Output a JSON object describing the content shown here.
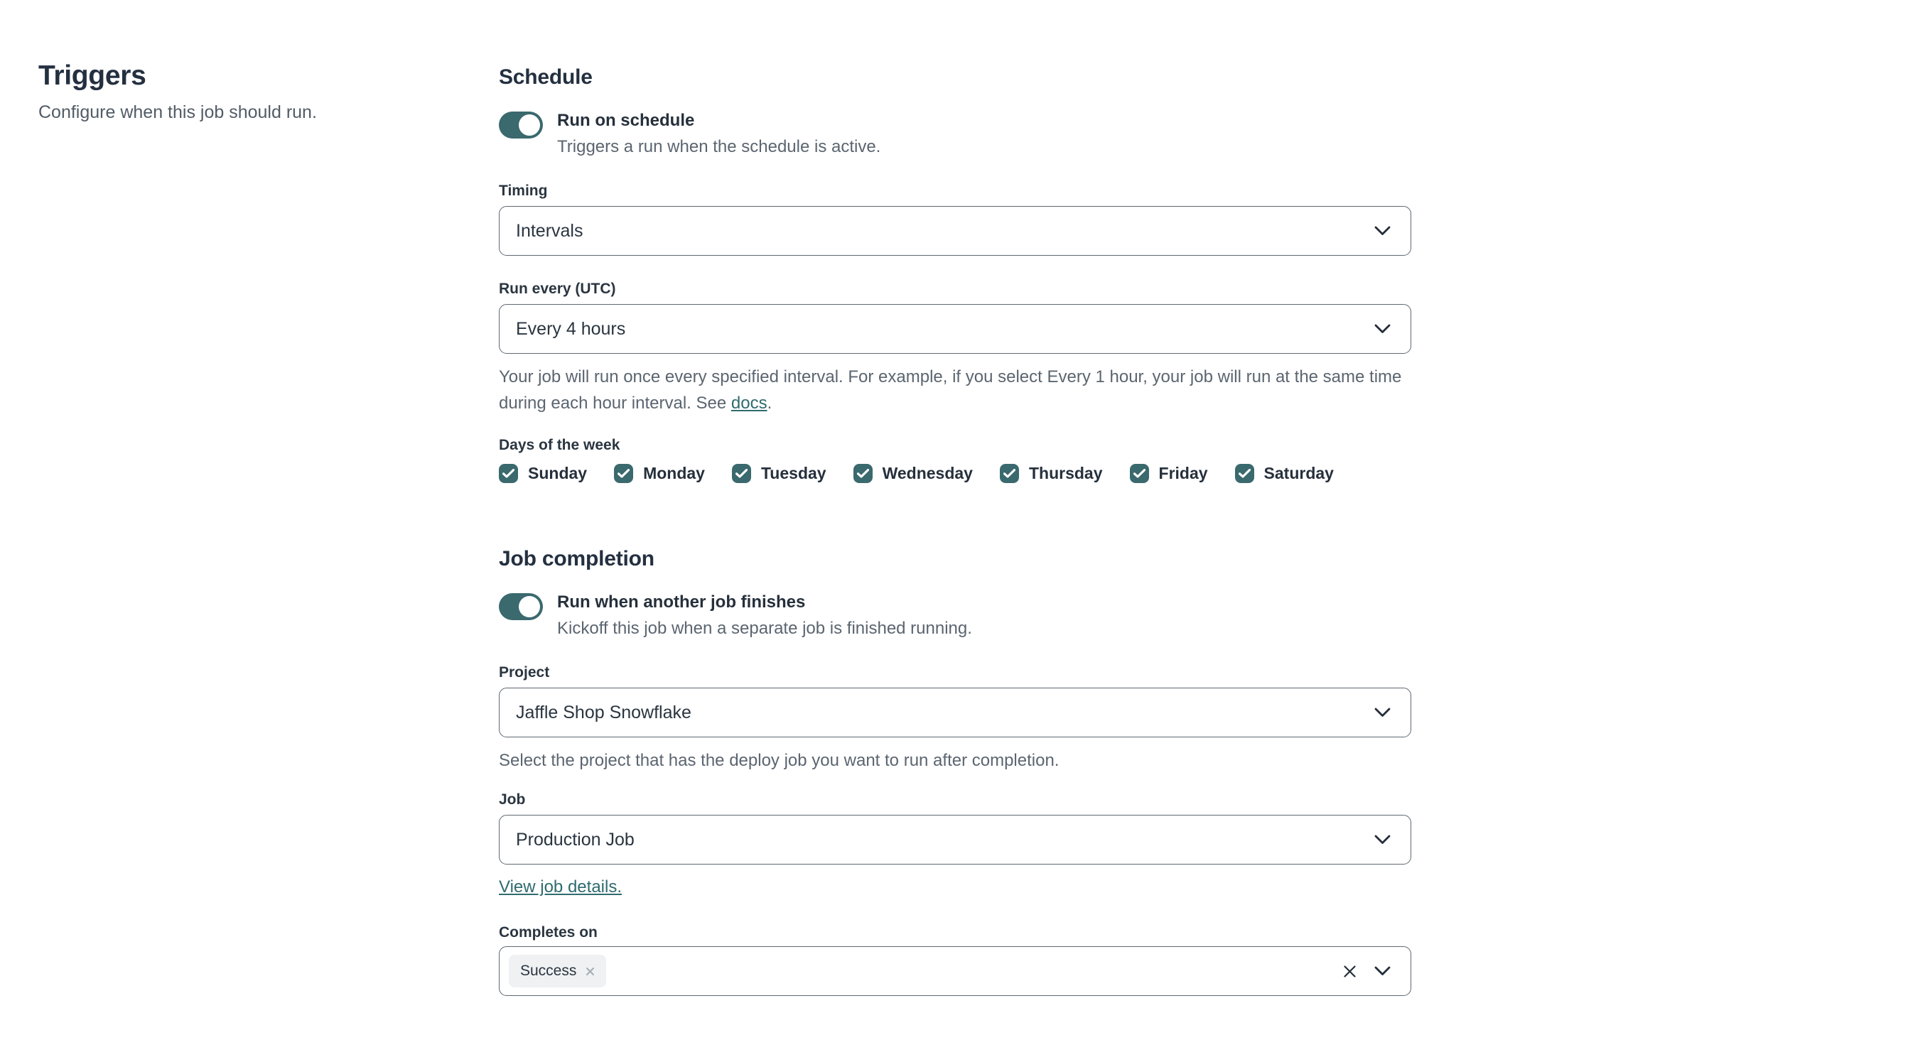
{
  "left": {
    "title": "Triggers",
    "subtitle": "Configure when this job should run."
  },
  "schedule": {
    "heading": "Schedule",
    "run_on_schedule": {
      "label": "Run on schedule",
      "description": "Triggers a run when the schedule is active.",
      "state": "on"
    },
    "timing": {
      "label": "Timing",
      "value": "Intervals"
    },
    "run_every": {
      "label": "Run every (UTC)",
      "value": "Every 4 hours",
      "help_text": "Your job will run once every specified interval. For example, if you select Every 1 hour, your job will run at the same time during each hour interval. See ",
      "help_link_label": "docs",
      "help_suffix": "."
    },
    "days": {
      "label": "Days of the week",
      "items": [
        {
          "label": "Sunday",
          "checked": true
        },
        {
          "label": "Monday",
          "checked": true
        },
        {
          "label": "Tuesday",
          "checked": true
        },
        {
          "label": "Wednesday",
          "checked": true
        },
        {
          "label": "Thursday",
          "checked": true
        },
        {
          "label": "Friday",
          "checked": true
        },
        {
          "label": "Saturday",
          "checked": true
        }
      ]
    }
  },
  "job_completion": {
    "heading": "Job completion",
    "run_when_finishes": {
      "label": "Run when another job finishes",
      "description": "Kickoff this job when a separate job is finished running.",
      "state": "on"
    },
    "project": {
      "label": "Project",
      "value": "Jaffle Shop Snowflake",
      "help_text": "Select the project that has the deploy job you want to run after completion."
    },
    "job": {
      "label": "Job",
      "value": "Production Job",
      "details_link_label": "View job details."
    },
    "completes_on": {
      "label": "Completes on",
      "chips": [
        {
          "label": "Success"
        }
      ]
    }
  },
  "colors": {
    "accent_teal": "#3a696e",
    "link_teal": "#2f6b6e",
    "heading_navy": "#243040",
    "secondary_gray": "#5b6570",
    "border_gray": "#5f6871",
    "chip_background": "#eff1f3"
  },
  "icons": {
    "chevron_down": "⌄",
    "check": "✓",
    "clear": "✕",
    "chip_remove": "×"
  }
}
